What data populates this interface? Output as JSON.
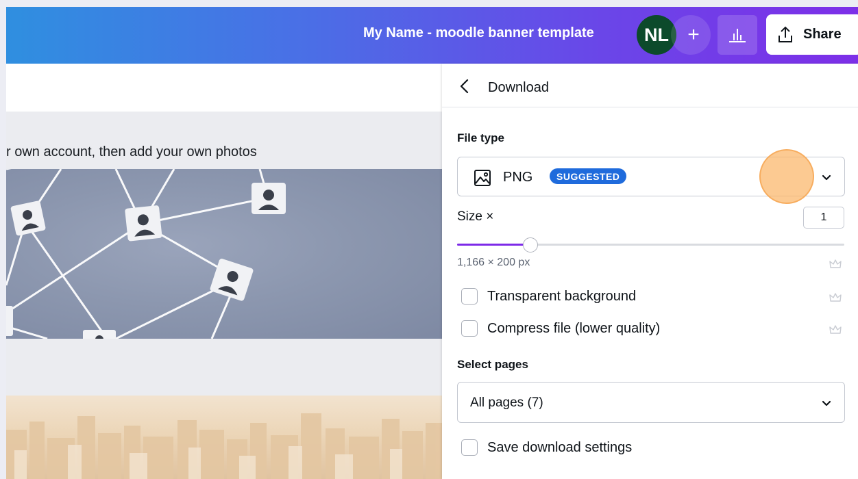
{
  "topbar": {
    "document_title": "My Name - moodle banner template",
    "avatar_initials": "NL",
    "add_member_glyph": "+",
    "insights_icon": "bar-chart-icon",
    "share_label": "Share",
    "share_icon": "upload-icon"
  },
  "canvas": {
    "page_caption": "r own account, then add your own photos"
  },
  "download_panel": {
    "title": "Download",
    "file_type": {
      "label": "File type",
      "selected": "PNG",
      "badge": "SUGGESTED"
    },
    "size": {
      "label": "Size ×",
      "value": "1",
      "slider_fraction": 0.19,
      "dimensions": "1,166 × 200 px"
    },
    "options": [
      {
        "label": "Transparent background",
        "checked": false,
        "premium": true
      },
      {
        "label": "Compress file (lower quality)",
        "checked": false,
        "premium": true
      }
    ],
    "select_pages": {
      "label": "Select pages",
      "selected": "All pages (7)"
    },
    "save_settings_label": "Save download settings"
  },
  "colors": {
    "accent": "#7d2ae8",
    "badge": "#1f6bdc",
    "avatar": "#0c4a2b",
    "highlight": "#fbb568"
  }
}
